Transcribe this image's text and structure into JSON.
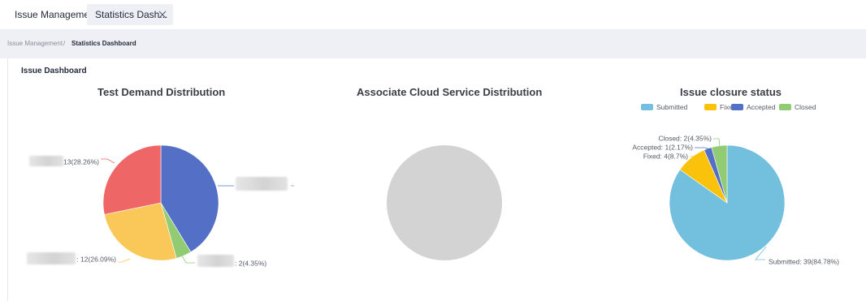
{
  "tabs": [
    {
      "label": "Issue Management"
    },
    {
      "label": "Statistics Dash..."
    }
  ],
  "breadcrumb": {
    "parent": "Issue Management",
    "separator": "/",
    "current": "Statistics Dashboard"
  },
  "card": {
    "title": "Issue Dashboard"
  },
  "chart_data": [
    {
      "type": "pie",
      "title": "Test Demand Distribution",
      "slices": [
        {
          "label": "",
          "value": 19,
          "text": "",
          "color": "#5470c6"
        },
        {
          "label": "",
          "value": 2,
          "text": ": 2(4.35%)",
          "color": "#91cc75"
        },
        {
          "label": "",
          "value": 12,
          "text": ": 12(26.09%)",
          "color": "#fac858"
        },
        {
          "label": "",
          "value": 13,
          "text": "13(28.26%)",
          "color": "#ee6666"
        }
      ]
    },
    {
      "type": "pie",
      "title": "Associate Cloud Service Distribution",
      "slices": [],
      "empty_color": "#d3d3d3"
    },
    {
      "type": "pie",
      "title": "Issue closure status",
      "legend": [
        "Submitted",
        "Fixed",
        "Accepted",
        "Closed"
      ],
      "legend_position": "top",
      "slices": [
        {
          "label": "Submitted",
          "value": 39,
          "text": "Submitted: 39(84.78%)",
          "color": "#73c0de"
        },
        {
          "label": "Fixed",
          "value": 4,
          "text": "Fixed: 4(8.7%)",
          "color": "#fac20a"
        },
        {
          "label": "Accepted",
          "value": 1,
          "text": "Accepted: 1(2.17%)",
          "color": "#5470c6"
        },
        {
          "label": "Closed",
          "value": 2,
          "text": "Closed: 2(4.35%)",
          "color": "#91cc75"
        }
      ]
    }
  ]
}
